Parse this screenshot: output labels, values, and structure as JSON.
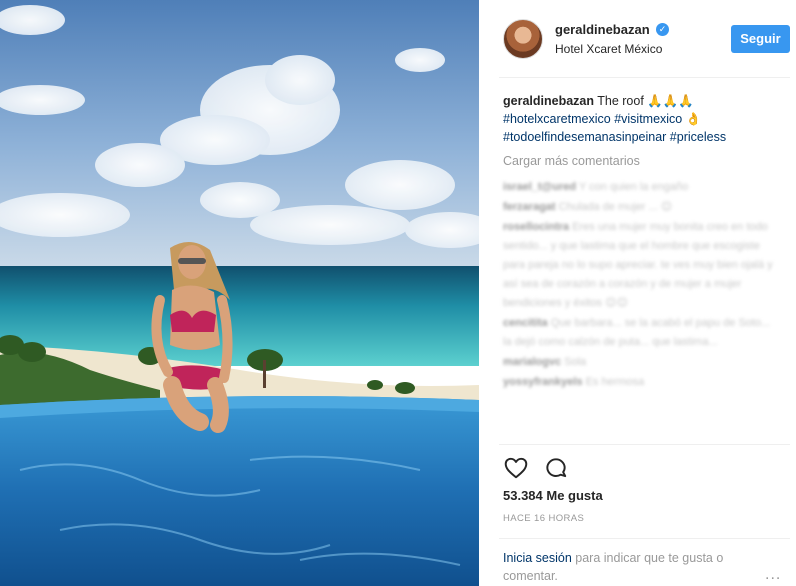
{
  "post": {
    "username": "geraldinebazan",
    "location": "Hotel Xcaret México",
    "follow_label": "Seguir",
    "verified_mark": "✓",
    "photo": {
      "description": "woman in pink bikini sitting on edge of infinity pool overlooking turquoise Caribbean sea and palm trees",
      "colors": {
        "sky": "#6c98c9",
        "sea": "#1f9db0",
        "pool": "#2d86c8",
        "bikini": "#c0245a"
      }
    }
  },
  "caption": {
    "username": "geraldinebazan",
    "text": "The roof 🙏🙏🙏",
    "tag1": "#hotelxcaretmexico",
    "tag2": "#visitmexico",
    "emoji": "👌",
    "tag3": "#todoelfindesemanasinpeinar",
    "tag4": "#priceless"
  },
  "load_more": "Cargar más comentarios",
  "comments": [
    {
      "user": "israel_t@ured",
      "text": "Y con quien la engaño"
    },
    {
      "user": "ferzaragat",
      "text": "Chulada de mujer ... 😊"
    },
    {
      "user": "rosellocintra",
      "text": "Eres una mujer muy bonita creo en todo sentido... y que lastima que el hombre que escogiste para pareja no lo supo apreciar. te ves muy bien ojalá y así sea de corazón a corazón y de mujer a mujer bendiciones y éxitos 😊😊"
    },
    {
      "user": "cencitita",
      "text": "Que barbara... se la acabó el papu de Soto... la dejó como calzón de puta... que lastima..."
    },
    {
      "user": "marialogvc",
      "text": "Sola"
    },
    {
      "user": "yossyfrankyels",
      "text": "Es hermosa"
    }
  ],
  "actions": {
    "like_icon": "heart-icon",
    "comment_icon": "comment-icon"
  },
  "likes": "53.384 Me gusta",
  "time": "HACE 16 HORAS",
  "login": {
    "link": "Inicia sesión",
    "rest": "para indicar que te gusta o comentar.",
    "more": "..."
  },
  "colors": {
    "accent": "#3897f0",
    "link": "#003569",
    "muted": "#999999"
  }
}
